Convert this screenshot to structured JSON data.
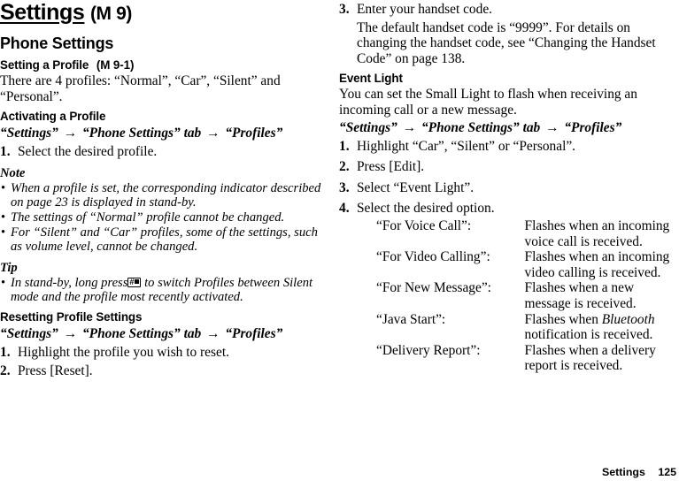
{
  "document": {
    "chapter_title": "Settings",
    "chapter_menu_ref": "(M 9)"
  },
  "footer": {
    "section_label": "Settings",
    "page_number": "125"
  },
  "left_column": {
    "section_heading": "Phone Settings",
    "setting_a_profile": {
      "heading": "Setting a Profile",
      "menu_ref": "(M 9-1)",
      "intro": "There are 4 profiles: “Normal”, “Car”, “Silent” and “Personal”."
    },
    "activating_a_profile": {
      "heading": "Activating a Profile",
      "path": [
        "“Settings”",
        "“Phone Settings” tab",
        "“Profiles”"
      ],
      "steps": [
        {
          "num": "1.",
          "text": "Select the desired profile."
        }
      ],
      "note_heading": "Note",
      "notes": [
        "When a profile is set, the corresponding indicator described on page 23 is displayed in stand-by.",
        "The settings of “Normal” profile cannot be changed.",
        "For “Silent” and “Car” profiles, some of the settings, such as volume level, cannot be changed."
      ],
      "tip_heading": "Tip",
      "tip_before_key": "In stand-by, long press",
      "tip_key_icon": "hash-key-icon",
      "tip_key_label": "#",
      "tip_after_key": "to switch Profiles between Silent mode and the profile most recently activated."
    },
    "resetting_profile_settings": {
      "heading": "Resetting Profile Settings",
      "path": [
        "“Settings”",
        "“Phone Settings” tab",
        "“Profiles”"
      ],
      "steps": [
        {
          "num": "1.",
          "text": "Highlight the profile you wish to reset."
        },
        {
          "num": "2.",
          "text": "Press [Reset]."
        }
      ]
    }
  },
  "right_column": {
    "continued_steps": [
      {
        "num": "3.",
        "text": "Enter your handset code."
      }
    ],
    "continued_note": "The default handset code is “9999”. For details on changing the handset code, see “Changing the Handset Code” on page 138.",
    "event_light": {
      "heading": "Event Light",
      "intro": "You can set the Small Light to flash when receiving an incoming call or a new message.",
      "path": [
        "“Settings”",
        "“Phone Settings” tab",
        "“Profiles”"
      ],
      "steps": [
        {
          "num": "1.",
          "text": "Highlight “Car”, “Silent” or “Personal”."
        },
        {
          "num": "2.",
          "text": "Press [Edit]."
        },
        {
          "num": "3.",
          "text": "Select “Event Light”."
        },
        {
          "num": "4.",
          "text": "Select the desired option."
        }
      ],
      "options": [
        {
          "term": "“For Voice Call”:",
          "desc": "Flashes when an incoming voice call is received."
        },
        {
          "term": "“For Video Calling”:",
          "desc": "Flashes when an incoming video calling is received."
        },
        {
          "term": "“For New Message”:",
          "desc": "Flashes when a new message is received."
        },
        {
          "term": "“Java Start”:",
          "desc_pre": "Flashes when ",
          "desc_em": "Bluetooth",
          "desc_post": " notification is received."
        },
        {
          "term": "“Delivery Report”:",
          "desc": "Flashes when a delivery report is received."
        }
      ]
    }
  },
  "arrow_glyph": "→"
}
